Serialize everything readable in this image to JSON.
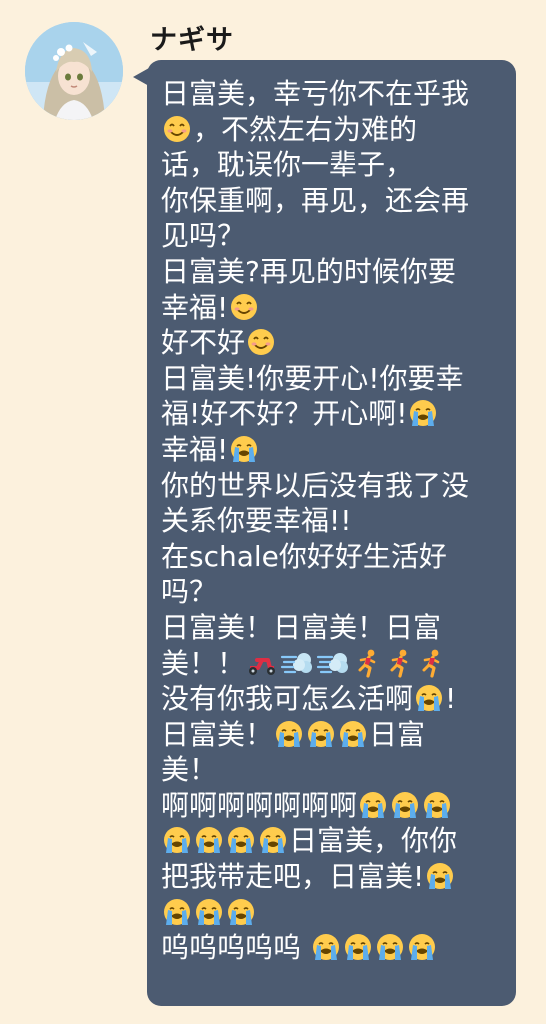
{
  "sender": {
    "name": "ナギサ",
    "avatar_icon": "character-avatar-icon"
  },
  "bubble": {
    "background": "#4c5b71",
    "text_color": "#ffffff",
    "lines": [
      [
        {
          "t": "text",
          "v": "日富美，幸亏你不在乎我"
        }
      ],
      [
        {
          "t": "emoji",
          "v": "smile"
        },
        {
          "t": "text",
          "v": "，不然左右为难的"
        }
      ],
      [
        {
          "t": "text",
          "v": "话，耽误你一辈子，"
        }
      ],
      [
        {
          "t": "text",
          "v": "你保重啊，再见，还会再"
        }
      ],
      [
        {
          "t": "text",
          "v": "见吗？"
        }
      ],
      [
        {
          "t": "text",
          "v": "日富美?再见的时候你要"
        }
      ],
      [
        {
          "t": "text",
          "v": "幸福!"
        },
        {
          "t": "emoji",
          "v": "smile"
        }
      ],
      [
        {
          "t": "text",
          "v": "好不好"
        },
        {
          "t": "emoji",
          "v": "smile"
        }
      ],
      [
        {
          "t": "text",
          "v": "日富美!你要开心!你要幸"
        }
      ],
      [
        {
          "t": "text",
          "v": "福!好不好？开心啊!"
        },
        {
          "t": "emoji",
          "v": "cry"
        }
      ],
      [
        {
          "t": "text",
          "v": "幸福!"
        },
        {
          "t": "emoji",
          "v": "cry"
        }
      ],
      [
        {
          "t": "text",
          "v": "你的世界以后没有我了没"
        }
      ],
      [
        {
          "t": "text",
          "v": "关系你要幸福!!"
        }
      ],
      [
        {
          "t": "text",
          "v": "在schale你好好生活好"
        }
      ],
      [
        {
          "t": "text",
          "v": "吗？"
        }
      ],
      [
        {
          "t": "text",
          "v": "日富美！日富美！日富"
        }
      ],
      [
        {
          "t": "text",
          "v": "美！！"
        },
        {
          "t": "emoji",
          "v": "scooter"
        },
        {
          "t": "emoji",
          "v": "dash"
        },
        {
          "t": "emoji",
          "v": "dash"
        },
        {
          "t": "emoji",
          "v": "run"
        },
        {
          "t": "emoji",
          "v": "run"
        },
        {
          "t": "emoji",
          "v": "run"
        }
      ],
      [
        {
          "t": "text",
          "v": "没有你我可怎么活啊"
        },
        {
          "t": "emoji",
          "v": "cry"
        },
        {
          "t": "text",
          "v": "!"
        }
      ],
      [
        {
          "t": "text",
          "v": "日富美！"
        },
        {
          "t": "emoji",
          "v": "cry"
        },
        {
          "t": "emoji",
          "v": "cry"
        },
        {
          "t": "emoji",
          "v": "cry"
        },
        {
          "t": "text",
          "v": "日富"
        }
      ],
      [
        {
          "t": "text",
          "v": "美！"
        }
      ],
      [
        {
          "t": "text",
          "v": "啊啊啊啊啊啊啊"
        },
        {
          "t": "emoji",
          "v": "cry"
        },
        {
          "t": "emoji",
          "v": "cry"
        },
        {
          "t": "emoji",
          "v": "cry"
        }
      ],
      [
        {
          "t": "emoji",
          "v": "cry"
        },
        {
          "t": "emoji",
          "v": "cry"
        },
        {
          "t": "emoji",
          "v": "cry"
        },
        {
          "t": "emoji",
          "v": "cry"
        },
        {
          "t": "text",
          "v": "日富美，你你"
        }
      ],
      [
        {
          "t": "text",
          "v": "把我带走吧，日富美!"
        },
        {
          "t": "emoji",
          "v": "cry"
        }
      ],
      [
        {
          "t": "emoji",
          "v": "cry"
        },
        {
          "t": "emoji",
          "v": "cry"
        },
        {
          "t": "emoji",
          "v": "cry"
        }
      ],
      [
        {
          "t": "text",
          "v": "呜呜呜呜呜 "
        },
        {
          "t": "emoji",
          "v": "cry"
        },
        {
          "t": "emoji",
          "v": "cry"
        },
        {
          "t": "emoji",
          "v": "cry"
        },
        {
          "t": "emoji",
          "v": "cry"
        }
      ]
    ]
  },
  "emoji_icons": {
    "cry": "loudly-crying-face-icon",
    "smile": "smiling-face-icon",
    "scooter": "motor-scooter-icon",
    "dash": "dash-icon",
    "run": "running-person-icon"
  }
}
